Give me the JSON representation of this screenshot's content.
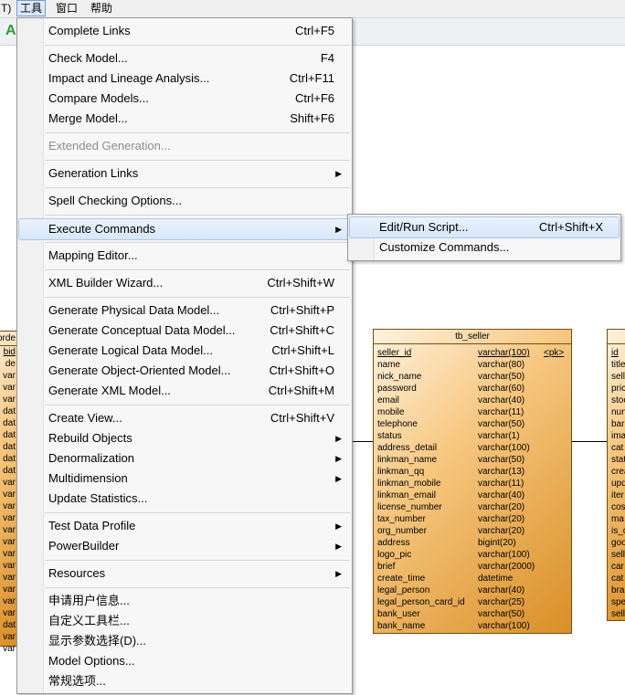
{
  "menubar": {
    "items": [
      "T)",
      "工具",
      "窗口",
      "帮助"
    ],
    "active_index": 1
  },
  "toolbar": {
    "first_icon": "A"
  },
  "tools_menu": {
    "items": [
      {
        "label": "Complete Links",
        "shortcut": "Ctrl+F5"
      },
      {
        "label": "Check Model...",
        "shortcut": "F4"
      },
      {
        "label": "Impact and Lineage Analysis...",
        "shortcut": "Ctrl+F11"
      },
      {
        "label": "Compare Models...",
        "shortcut": "Ctrl+F6"
      },
      {
        "label": "Merge Model...",
        "shortcut": "Shift+F6"
      },
      {
        "label": "Extended Generation...",
        "shortcut": "",
        "disabled": true
      },
      {
        "label": "Generation Links",
        "shortcut": "",
        "submenu": true
      },
      {
        "label": "Spell Checking Options...",
        "shortcut": ""
      },
      {
        "label": "Execute Commands",
        "shortcut": "",
        "submenu": true,
        "highlighted": true
      },
      {
        "label": "Mapping Editor...",
        "shortcut": ""
      },
      {
        "label": "XML Builder Wizard...",
        "shortcut": "Ctrl+Shift+W"
      },
      {
        "label": "Generate Physical Data Model...",
        "shortcut": "Ctrl+Shift+P"
      },
      {
        "label": "Generate Conceptual Data Model...",
        "shortcut": "Ctrl+Shift+C"
      },
      {
        "label": "Generate Logical Data Model...",
        "shortcut": "Ctrl+Shift+L"
      },
      {
        "label": "Generate Object-Oriented Model...",
        "shortcut": "Ctrl+Shift+O"
      },
      {
        "label": "Generate XML Model...",
        "shortcut": "Ctrl+Shift+M"
      },
      {
        "label": "Create View...",
        "shortcut": "Ctrl+Shift+V"
      },
      {
        "label": "Rebuild Objects",
        "shortcut": "",
        "submenu": true
      },
      {
        "label": "Denormalization",
        "shortcut": "",
        "submenu": true
      },
      {
        "label": "Multidimension",
        "shortcut": "",
        "submenu": true
      },
      {
        "label": "Update Statistics...",
        "shortcut": ""
      },
      {
        "label": "Test Data Profile",
        "shortcut": "",
        "submenu": true
      },
      {
        "label": "PowerBuilder",
        "shortcut": "",
        "submenu": true
      },
      {
        "label": "Resources",
        "shortcut": "",
        "submenu": true
      },
      {
        "label": "申请用户信息...",
        "shortcut": ""
      },
      {
        "label": "自定义工具栏...",
        "shortcut": ""
      },
      {
        "label": "显示参数选择(D)...",
        "shortcut": ""
      },
      {
        "label": "Model Options...",
        "shortcut": ""
      },
      {
        "label": "常规选项...",
        "shortcut": ""
      }
    ]
  },
  "execute_submenu": {
    "items": [
      {
        "label": "Edit/Run Script...",
        "shortcut": "Ctrl+Shift+X",
        "highlighted": true
      },
      {
        "label": "Customize Commands...",
        "shortcut": ""
      }
    ]
  },
  "tb_seller": {
    "title": "tb_seller",
    "columns": [
      {
        "name": "seller_id",
        "type": "varchar(100)",
        "key": "<pk>"
      },
      {
        "name": "name",
        "type": "varchar(80)",
        "key": ""
      },
      {
        "name": "nick_name",
        "type": "varchar(50)",
        "key": ""
      },
      {
        "name": "password",
        "type": "varchar(60)",
        "key": ""
      },
      {
        "name": "email",
        "type": "varchar(40)",
        "key": ""
      },
      {
        "name": "mobile",
        "type": "varchar(11)",
        "key": ""
      },
      {
        "name": "telephone",
        "type": "varchar(50)",
        "key": ""
      },
      {
        "name": "status",
        "type": "varchar(1)",
        "key": ""
      },
      {
        "name": "address_detail",
        "type": "varchar(100)",
        "key": ""
      },
      {
        "name": "linkman_name",
        "type": "varchar(50)",
        "key": ""
      },
      {
        "name": "linkman_qq",
        "type": "varchar(13)",
        "key": ""
      },
      {
        "name": "linkman_mobile",
        "type": "varchar(11)",
        "key": ""
      },
      {
        "name": "linkman_email",
        "type": "varchar(40)",
        "key": ""
      },
      {
        "name": "license_number",
        "type": "varchar(20)",
        "key": ""
      },
      {
        "name": "tax_number",
        "type": "varchar(20)",
        "key": ""
      },
      {
        "name": "org_number",
        "type": "varchar(20)",
        "key": ""
      },
      {
        "name": "address",
        "type": "bigint(20)",
        "key": ""
      },
      {
        "name": "logo_pic",
        "type": "varchar(100)",
        "key": ""
      },
      {
        "name": "brief",
        "type": "varchar(2000)",
        "key": ""
      },
      {
        "name": "create_time",
        "type": "datetime",
        "key": ""
      },
      {
        "name": "legal_person",
        "type": "varchar(40)",
        "key": ""
      },
      {
        "name": "legal_person_card_id",
        "type": "varchar(25)",
        "key": ""
      },
      {
        "name": "bank_user",
        "type": "varchar(50)",
        "key": ""
      },
      {
        "name": "bank_name",
        "type": "varchar(100)",
        "key": ""
      }
    ]
  },
  "left_table": {
    "title": "orde",
    "rows": [
      "bid",
      "de",
      "var",
      "var",
      "var",
      "dat",
      "dat",
      "dat",
      "dat",
      "dat",
      "dat",
      "var",
      "var",
      "var",
      "var",
      "var",
      "var",
      "var",
      "var",
      "var",
      "var",
      "var",
      "var",
      "dat",
      "var",
      "var"
    ]
  },
  "right_table": {
    "title": "",
    "rows": [
      "id",
      "title",
      "sell",
      "pric",
      "stoc",
      "nun",
      "bar",
      "ima",
      "cat",
      "stat",
      "crea",
      "upd",
      "iter",
      "cos",
      "ma",
      "is_c",
      "goo",
      "sell",
      "car",
      "cat",
      "bra",
      "spe",
      "sell"
    ]
  }
}
